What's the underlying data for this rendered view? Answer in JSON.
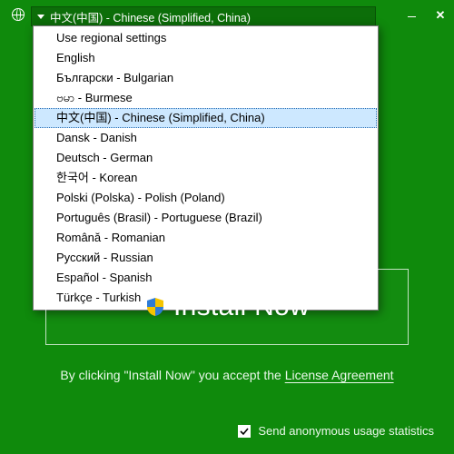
{
  "combo": {
    "selected_label": "中文(中国) - Chinese (Simplified, China)"
  },
  "dropdown": {
    "items": [
      {
        "label": "Use regional settings",
        "selected": false
      },
      {
        "label": "English",
        "selected": false
      },
      {
        "label": "Български - Bulgarian",
        "selected": false
      },
      {
        "label": "ဗမာ - Burmese",
        "selected": false
      },
      {
        "label": "中文(中国) - Chinese (Simplified, China)",
        "selected": true
      },
      {
        "label": "Dansk - Danish",
        "selected": false
      },
      {
        "label": "Deutsch - German",
        "selected": false
      },
      {
        "label": "한국어 - Korean",
        "selected": false
      },
      {
        "label": "Polski (Polska) - Polish (Poland)",
        "selected": false
      },
      {
        "label": "Português (Brasil) - Portuguese (Brazil)",
        "selected": false
      },
      {
        "label": "Română - Romanian",
        "selected": false
      },
      {
        "label": "Русский - Russian",
        "selected": false
      },
      {
        "label": "Español - Spanish",
        "selected": false
      },
      {
        "label": "Türkçe - Turkish",
        "selected": false
      }
    ]
  },
  "install": {
    "label": "Install Now"
  },
  "license": {
    "prefix": "By clicking \"Install Now\" you accept the ",
    "link": "License Agreement"
  },
  "stats": {
    "checked": true,
    "label": "Send anonymous usage statistics"
  }
}
